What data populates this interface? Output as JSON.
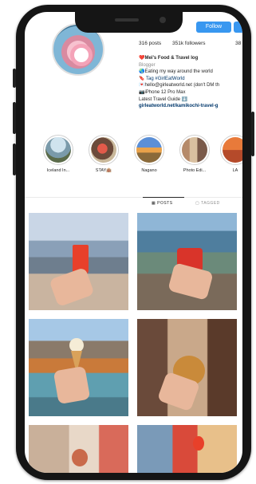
{
  "profile": {
    "follow_label": "Follow",
    "stats": {
      "posts": "316 posts",
      "followers": "351k followers",
      "following": "38"
    },
    "bio": [
      "❤️Mei's Food & Travel log",
      "Blogger",
      "🌏Eating my way around the world",
      "🔖 Tag #GirlEatWorld",
      "💌hello@girleatworld.net (don't DM th",
      "📷iPhone 12 Pro Max",
      "Latest Travel Guide ⬇️",
      "girleatworld.net/kamikochi-travel-g"
    ]
  },
  "highlights": [
    {
      "label": "Iceland In..."
    },
    {
      "label": "STAY🏨"
    },
    {
      "label": "Nagano"
    },
    {
      "label": "Photo Edi..."
    },
    {
      "label": "LA"
    }
  ],
  "tabs": {
    "posts": "POSTS",
    "tagged": "TAGGED"
  },
  "icons": [
    "grid-icon",
    "tag-icon",
    "avatar-image"
  ]
}
